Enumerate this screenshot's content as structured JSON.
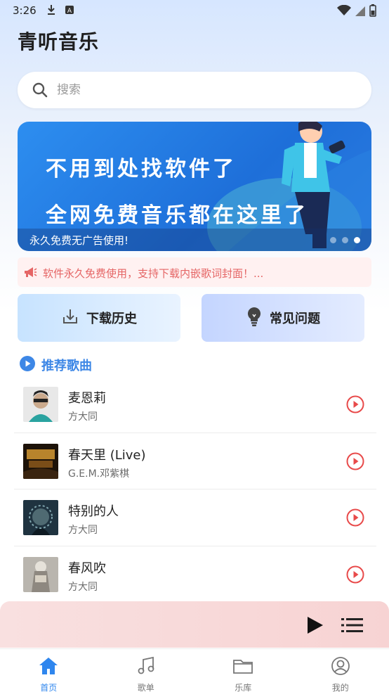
{
  "status_bar": {
    "time": "3:26"
  },
  "app": {
    "title": "青听音乐"
  },
  "search": {
    "placeholder": "搜索"
  },
  "banner": {
    "line1": "不用到处找软件了",
    "line2": "全网免费音乐都在这里了",
    "caption": "永久免费无广告使用!",
    "dots": 3,
    "active_dot": 3
  },
  "notice": {
    "text": "软件永久免费使用，支持下载内嵌歌词封面！..."
  },
  "quick_actions": [
    {
      "label": "下载历史",
      "icon": "download-icon"
    },
    {
      "label": "常见问题",
      "icon": "lightbulb-icon"
    }
  ],
  "section": {
    "title": "推荐歌曲"
  },
  "songs": [
    {
      "title": "麦恩莉",
      "artist": "方大同"
    },
    {
      "title": "春天里 (Live)",
      "artist": "G.E.M.邓紫棋"
    },
    {
      "title": "特别的人",
      "artist": "方大同"
    },
    {
      "title": "春风吹",
      "artist": "方大同"
    }
  ],
  "tabs": [
    {
      "label": "首页",
      "icon": "home-icon",
      "active": true
    },
    {
      "label": "歌单",
      "icon": "music-note-icon",
      "active": false
    },
    {
      "label": "乐库",
      "icon": "folder-icon",
      "active": false
    },
    {
      "label": "我的",
      "icon": "user-icon",
      "active": false
    }
  ],
  "colors": {
    "accent": "#2f86ee",
    "notice_text": "#e56565",
    "play_red": "#e84a4a",
    "section_blue": "#3d87e6"
  }
}
